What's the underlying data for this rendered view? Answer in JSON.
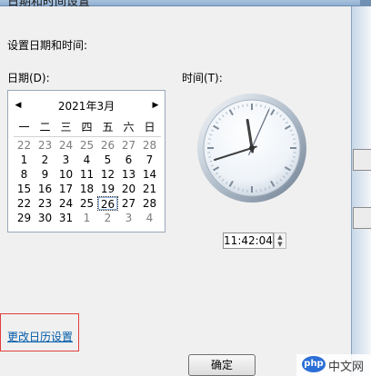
{
  "window": {
    "title": "日期和时间设置"
  },
  "labels": {
    "heading": "设置日期和时间:",
    "date": "日期(D):",
    "time": "时间(T):"
  },
  "calendar": {
    "month_title": "2021年3月",
    "weekdays": [
      "一",
      "二",
      "三",
      "四",
      "五",
      "六",
      "日"
    ],
    "days": [
      {
        "text": "22",
        "muted": true
      },
      {
        "text": "23",
        "muted": true
      },
      {
        "text": "24",
        "muted": true
      },
      {
        "text": "25",
        "muted": true
      },
      {
        "text": "26",
        "muted": true
      },
      {
        "text": "27",
        "muted": true
      },
      {
        "text": "28",
        "muted": true
      },
      {
        "text": "1",
        "muted": false
      },
      {
        "text": "2",
        "muted": false
      },
      {
        "text": "3",
        "muted": false
      },
      {
        "text": "4",
        "muted": false
      },
      {
        "text": "5",
        "muted": false
      },
      {
        "text": "6",
        "muted": false
      },
      {
        "text": "7",
        "muted": false
      },
      {
        "text": "8",
        "muted": false
      },
      {
        "text": "9",
        "muted": false
      },
      {
        "text": "10",
        "muted": false
      },
      {
        "text": "11",
        "muted": false
      },
      {
        "text": "12",
        "muted": false
      },
      {
        "text": "13",
        "muted": false
      },
      {
        "text": "14",
        "muted": false
      },
      {
        "text": "15",
        "muted": false
      },
      {
        "text": "16",
        "muted": false
      },
      {
        "text": "17",
        "muted": false
      },
      {
        "text": "18",
        "muted": false
      },
      {
        "text": "19",
        "muted": false
      },
      {
        "text": "20",
        "muted": false
      },
      {
        "text": "21",
        "muted": false
      },
      {
        "text": "22",
        "muted": false
      },
      {
        "text": "23",
        "muted": false
      },
      {
        "text": "24",
        "muted": false
      },
      {
        "text": "25",
        "muted": false
      },
      {
        "text": "26",
        "muted": false,
        "selected": true
      },
      {
        "text": "27",
        "muted": false
      },
      {
        "text": "28",
        "muted": false
      },
      {
        "text": "29",
        "muted": false
      },
      {
        "text": "30",
        "muted": false
      },
      {
        "text": "31",
        "muted": false
      },
      {
        "text": "1",
        "muted": true
      },
      {
        "text": "2",
        "muted": true
      },
      {
        "text": "3",
        "muted": true
      },
      {
        "text": "4",
        "muted": true
      }
    ]
  },
  "clock": {
    "time_value": "11:42:04",
    "hour": 11,
    "minute": 42,
    "second": 4
  },
  "links": {
    "change_calendar_settings": "更改日历设置"
  },
  "buttons": {
    "ok": "确定"
  },
  "watermark": {
    "logo_text": "php",
    "site_text": "中文网"
  }
}
